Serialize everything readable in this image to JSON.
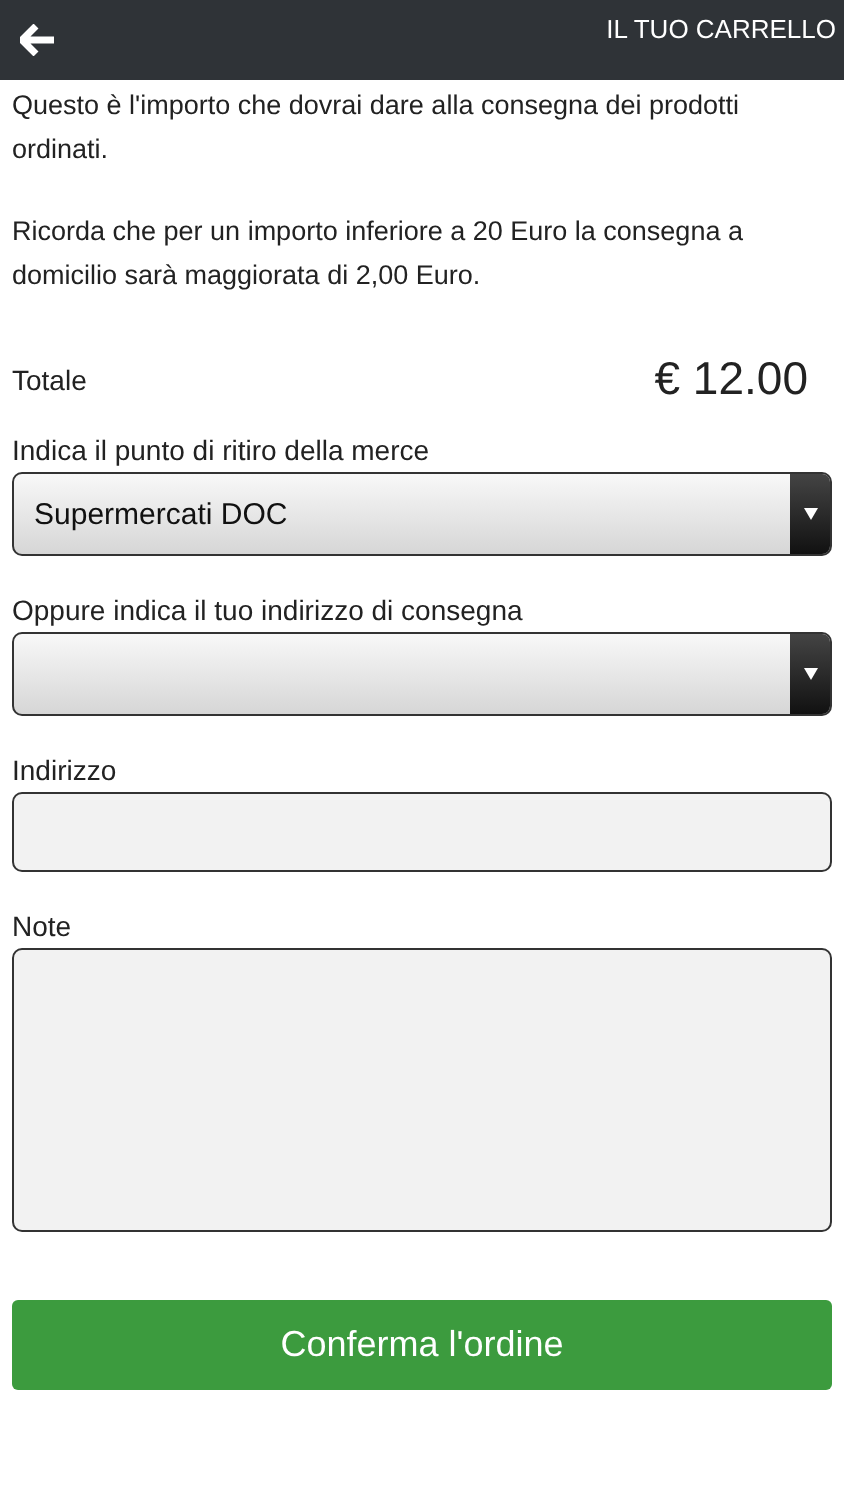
{
  "header": {
    "title": "IL TUO CARRELLO"
  },
  "intro": [
    "Questo è l'importo che dovrai dare alla consegna dei prodotti ordinati.",
    "Ricorda che per un importo inferiore a 20 Euro la consegna a domicilio sarà maggiorata di 2,00 Euro."
  ],
  "total": {
    "label": "Totale",
    "value": "€ 12.00"
  },
  "fields": [
    {
      "kind": "select",
      "label": "Indica il punto di ritiro della merce",
      "value": "Supermercati DOC"
    },
    {
      "kind": "select",
      "label": "Oppure indica il tuo indirizzo di consegna"
    },
    {
      "kind": "input",
      "label": "Indirizzo"
    },
    {
      "kind": "textarea",
      "label": "Note"
    }
  ],
  "button": "Conferma l'ordine"
}
